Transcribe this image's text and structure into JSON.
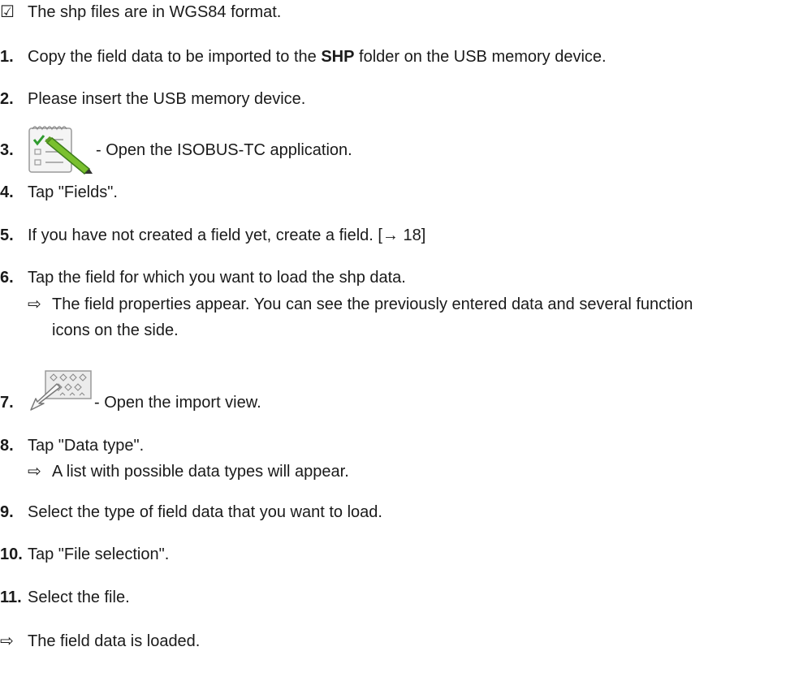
{
  "prerequisite": {
    "symbol": "☑",
    "text": "The shp files are in WGS84 format."
  },
  "steps": [
    {
      "num": "1.",
      "before": "Copy the field data to be imported to the ",
      "bold": "SHP",
      "after": " folder on the USB memory device."
    },
    {
      "num": "2.",
      "text": "Please insert the USB memory device."
    },
    {
      "num": "3.",
      "icon": "isobus-tc-app-icon",
      "text": " - Open the ISOBUS-TC application."
    },
    {
      "num": "4.",
      "text": "Tap \"Fields\"."
    },
    {
      "num": "5.",
      "text": " If you have not created a field yet, create a field. [→ 18]"
    },
    {
      "num": "6.",
      "text": "Tap the field for which you want to load the shp data.",
      "result_line1": "The field properties appear. You can see the previously entered data and several function",
      "result_line2": "icons on the side."
    },
    {
      "num": "7.",
      "icon": "import-view-icon",
      "text": " - Open the import view."
    },
    {
      "num": "8.",
      "text": "Tap \"Data type\".",
      "result": "A list with possible data types will appear."
    },
    {
      "num": "9.",
      "text": "Select the type of field data that you want to load."
    },
    {
      "num": "10.",
      "text": "Tap \"File selection\"."
    },
    {
      "num": "11.",
      "text": "Select the file."
    }
  ],
  "final_result": "The field data is loaded.",
  "result_symbol": "⇨"
}
